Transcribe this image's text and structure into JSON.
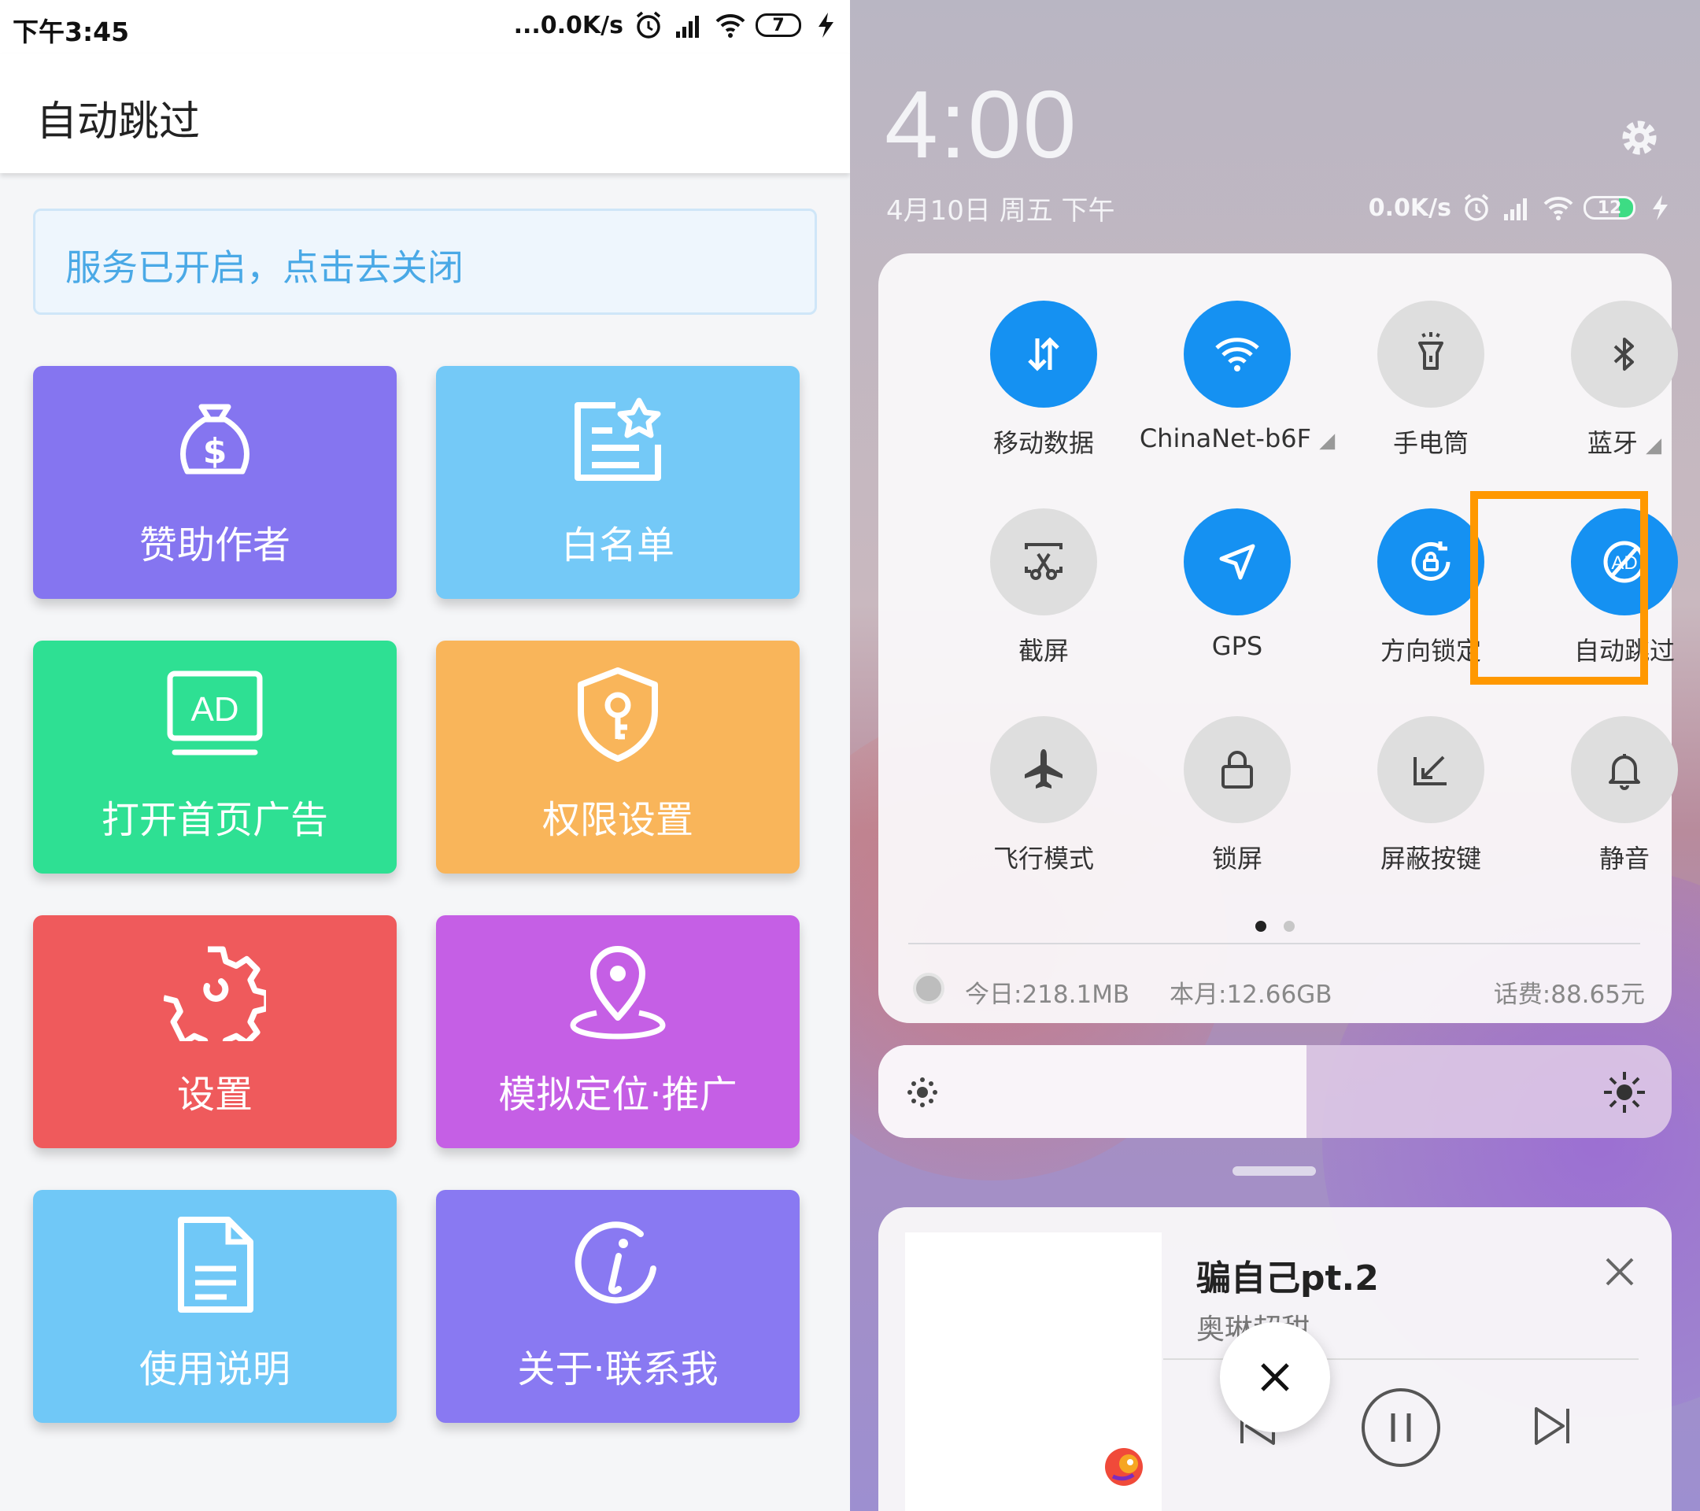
{
  "left": {
    "status": {
      "time": "下午3:45",
      "network_speed": "...0.0K/s",
      "battery": "7"
    },
    "appbar": {
      "title": "自动跳过"
    },
    "service_banner": "服务已开启，点击去关闭",
    "tiles": [
      {
        "label": "赞助作者",
        "icon": "money-bag-icon",
        "color": "#8575f0"
      },
      {
        "label": "白名单",
        "icon": "whitelist-icon",
        "color": "#74c9f7"
      },
      {
        "label": "打开首页广告",
        "icon": "ad-icon",
        "color": "#2ee093"
      },
      {
        "label": "权限设置",
        "icon": "shield-key-icon",
        "color": "#f9b55a"
      },
      {
        "label": "设置",
        "icon": "gear-icon",
        "color": "#ef5a5c"
      },
      {
        "label": "模拟定位·推广",
        "icon": "location-pin-icon",
        "color": "#c55fe5"
      },
      {
        "label": "使用说明",
        "icon": "document-icon",
        "color": "#70c8f7"
      },
      {
        "label": "关于·联系我",
        "icon": "info-icon",
        "color": "#8979f2"
      }
    ]
  },
  "right": {
    "clock": "4:00",
    "date": "4月10日 周五 下午",
    "network_speed": "0.0K/s",
    "battery": "12",
    "toggles": [
      {
        "label": "移动数据",
        "icon": "mobile-data-icon",
        "on": true,
        "arrow": false
      },
      {
        "label": "ChinaNet-b6F",
        "icon": "wifi-icon",
        "on": true,
        "arrow": true
      },
      {
        "label": "手电筒",
        "icon": "flashlight-icon",
        "on": false,
        "arrow": false
      },
      {
        "label": "蓝牙",
        "icon": "bluetooth-icon",
        "on": false,
        "arrow": true
      },
      {
        "label": "截屏",
        "icon": "screenshot-icon",
        "on": false,
        "arrow": false
      },
      {
        "label": "GPS",
        "icon": "gps-icon",
        "on": true,
        "arrow": false
      },
      {
        "label": "方向锁定",
        "icon": "rotation-lock-icon",
        "on": true,
        "arrow": false
      },
      {
        "label": "自动跳过",
        "icon": "ad-skip-icon",
        "on": true,
        "arrow": false
      },
      {
        "label": "飞行模式",
        "icon": "airplane-icon",
        "on": false,
        "arrow": false
      },
      {
        "label": "锁屏",
        "icon": "lock-icon",
        "on": false,
        "arrow": false
      },
      {
        "label": "屏蔽按键",
        "icon": "block-keys-icon",
        "on": false,
        "arrow": false
      },
      {
        "label": "静音",
        "icon": "bell-icon",
        "on": false,
        "arrow": false
      }
    ],
    "data_usage": {
      "today": "今日:218.1MB",
      "month": "本月:12.66GB",
      "fee": "话费:88.65元"
    },
    "brightness_level": 0.54,
    "media": {
      "title": "骗自己pt.2",
      "artist": "奥琳超甜"
    },
    "colors": {
      "toggle_on": "#1591f2",
      "toggle_off": "#dedede",
      "highlight": "#ff9800"
    }
  }
}
